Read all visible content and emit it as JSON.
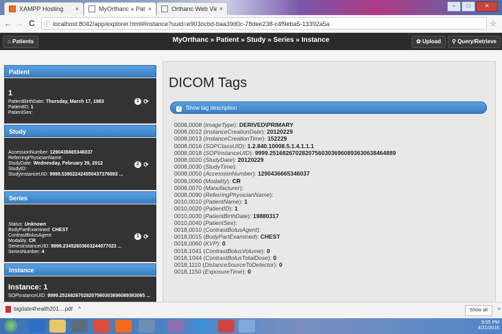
{
  "browser": {
    "tabs": [
      {
        "label": "XAMPP Hosting",
        "active": false
      },
      {
        "label": "MyOrthanc » Patient » S",
        "active": true
      },
      {
        "label": "Orthanc Web Viewer",
        "active": false
      }
    ],
    "tab_close": "×",
    "url": "localhost:8042/app/explorer.html#instance?uuid=e903ocbd-baa39d0c-78dee238-c4f9eba5-13392a5a",
    "back": "←",
    "forward": "→",
    "reload": "C",
    "info_icon": "ⓘ",
    "star": "☆",
    "window_buttons": {
      "min": "–",
      "max": "□",
      "close": "✕"
    }
  },
  "navbar": {
    "patients_label": "Patients",
    "breadcrumb": "MyOrthanc » Patient » Study » Series » Instance",
    "upload_label": "Upload",
    "query_label": "Query/Retrieve"
  },
  "sections": {
    "patient": {
      "header": "Patient",
      "big": "1",
      "fields": [
        {
          "k": "PatientBirthDate: ",
          "v": "Thursday, March 17, 1983"
        },
        {
          "k": "PatientID: ",
          "v": "1"
        },
        {
          "k": "PatientSex: ",
          "v": ""
        }
      ],
      "count": "1"
    },
    "study": {
      "header": "Study",
      "fields": [
        {
          "k": "AccessionNumber: ",
          "v": "1290436665346037"
        },
        {
          "k": "ReferringPhysicianName: ",
          "v": ""
        },
        {
          "k": "StudyDate: ",
          "v": "Wednesday, February 29, 2012"
        },
        {
          "k": "StudyID: ",
          "v": ""
        },
        {
          "k": "StudyInstanceUID: ",
          "v": "9999.539022424550437376693 ..."
        }
      ],
      "count": "2"
    },
    "series": {
      "header": "Series",
      "status_label": "Status: ",
      "status_value": "Unknown",
      "fields": [
        {
          "k": "BodyPartExamined: ",
          "v": "CHEST"
        },
        {
          "k": "ContrastBolusAgent: ",
          "v": ""
        },
        {
          "k": "Modality: ",
          "v": "CR"
        },
        {
          "k": "SeriesInstanceUID: ",
          "v": "9999.23452603603244077023 ..."
        },
        {
          "k": "SeriesNumber: ",
          "v": "4"
        }
      ],
      "count": "1"
    },
    "instance": {
      "header": "Instance",
      "big": "Instance: 1",
      "field_k": "SOPInstanceUID: ",
      "field_v": "9999.25168267028207560303696089363065 ..."
    }
  },
  "main": {
    "title": "DICOM Tags",
    "toggle_label": "Show tag description",
    "tags": [
      {
        "code": "0008,0008",
        "name": "ImageType",
        "value": "DERIVED\\PRIMARY"
      },
      {
        "code": "0008,0012",
        "name": "InstanceCreationDate",
        "value": "20120229"
      },
      {
        "code": "0008,0013",
        "name": "InstanceCreationTime",
        "value": "152229"
      },
      {
        "code": "0008,0016",
        "name": "SOPClassUID",
        "value": "1.2.840.10008.5.1.4.1.1.1"
      },
      {
        "code": "0008,0018",
        "name": "SOPInstanceUID",
        "value": "9999.251682670282075603036960893630638464889"
      },
      {
        "code": "0008,0020",
        "name": "StudyDate",
        "value": "20120229"
      },
      {
        "code": "0008,0030",
        "name": "StudyTime",
        "value": ""
      },
      {
        "code": "0008,0050",
        "name": "AccessionNumber",
        "value": "1290436665346037"
      },
      {
        "code": "0008,0060",
        "name": "Modality",
        "value": "CR"
      },
      {
        "code": "0008,0070",
        "name": "Manufacturer",
        "value": ""
      },
      {
        "code": "0008,0090",
        "name": "ReferringPhysicianName",
        "value": ""
      },
      {
        "code": "0010,0010",
        "name": "PatientName",
        "value": "1"
      },
      {
        "code": "0010,0020",
        "name": "PatientID",
        "value": "1"
      },
      {
        "code": "0010,0030",
        "name": "PatientBirthDate",
        "value": "19880317"
      },
      {
        "code": "0010,0040",
        "name": "PatientSex",
        "value": ""
      },
      {
        "code": "0018,0010",
        "name": "ContrastBolusAgent",
        "value": ""
      },
      {
        "code": "0018,0015",
        "name": "BodyPartExamined",
        "value": "CHEST"
      },
      {
        "code": "0018,0060",
        "name": "KVP",
        "value": "0"
      },
      {
        "code": "0018,1041",
        "name": "ContrastBolusVolume",
        "value": "0"
      },
      {
        "code": "0018,1044",
        "name": "ContrastBolusTotalDose",
        "value": "0"
      },
      {
        "code": "0018,1110",
        "name": "DistanceSourceToDetector",
        "value": "0"
      },
      {
        "code": "0018,1150",
        "name": "ExposureTime",
        "value": "0"
      }
    ]
  },
  "download": {
    "file": "bigdate4health201....pdf",
    "caret": "^",
    "show_all": "Show all",
    "close": "×"
  },
  "tray": {
    "time": "9:55 PM",
    "date": "4/21/2018"
  }
}
